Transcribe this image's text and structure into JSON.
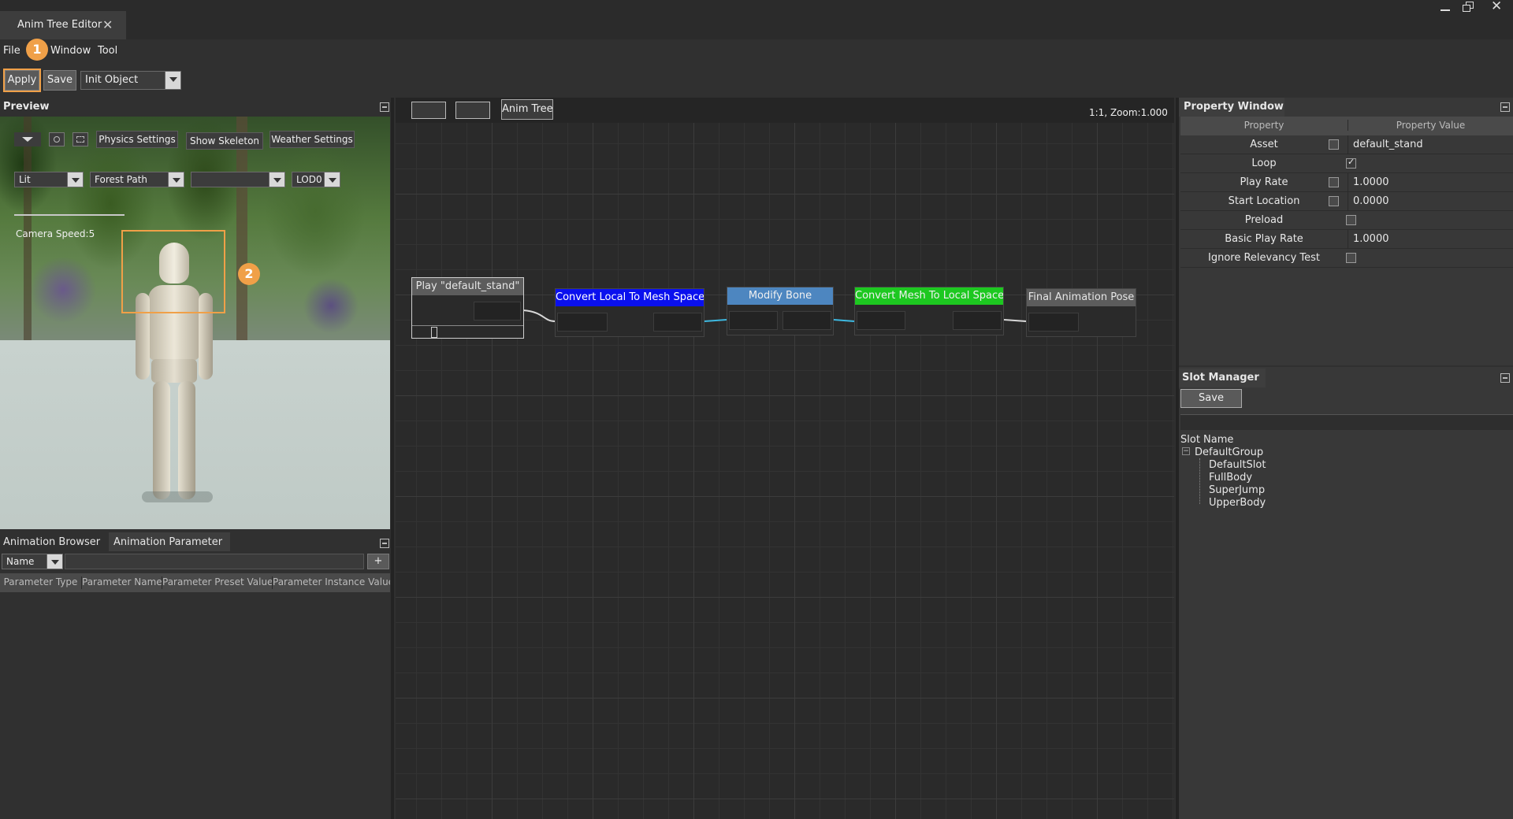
{
  "window": {
    "tab_title": "Anim Tree Editor"
  },
  "menu": [
    "File",
    "Window",
    "Tool"
  ],
  "toolbar": {
    "apply_label": "Apply",
    "save_label": "Save",
    "object_select": "Init Object"
  },
  "preview": {
    "title": "Preview",
    "physics_settings": "Physics Settings",
    "show_skeleton": "Show Skeleton",
    "weather_settings": "Weather Settings",
    "lighting_mode": "Lit",
    "environment": "Forest Path",
    "third_select": "",
    "lod": "LOD0",
    "camera_speed": "Camera Speed:5"
  },
  "bottom_left": {
    "tabs": [
      "Animation Browser",
      "Animation Parameter"
    ],
    "filter_select": "Name",
    "filter_value": "",
    "add_label": "+",
    "columns": [
      "Parameter Type",
      "Parameter Name",
      "Parameter Preset Value",
      "Parameter Instance Value"
    ]
  },
  "graph": {
    "breadcrumb_tab": "Anim Tree",
    "zoom_label": "1:1, Zoom:1.000",
    "nodes": {
      "play": "Play \"default_stand\"",
      "local_to_mesh": "Convert Local To Mesh Space",
      "modify_bone": "Modify Bone",
      "mesh_to_local": "Convert Mesh To Local Space",
      "final": "Final Animation Pose"
    }
  },
  "property_window": {
    "title": "Property Window",
    "header_property": "Property",
    "header_value": "Property Value",
    "rows": [
      {
        "label": "Asset",
        "value": "default_stand"
      },
      {
        "label": "Loop",
        "value": ""
      },
      {
        "label": "Play Rate",
        "value": "1.0000"
      },
      {
        "label": "Start Location",
        "value": "0.0000"
      },
      {
        "label": "Preload",
        "value": ""
      },
      {
        "label": "Basic Play Rate",
        "value": "1.0000"
      },
      {
        "label": "Ignore Relevancy Test",
        "value": ""
      }
    ],
    "loop_checked": true
  },
  "slot_manager": {
    "title": "Slot Manager",
    "save_label": "Save",
    "slot_name_label": "Slot Name",
    "group": "DefaultGroup",
    "slots": [
      "DefaultSlot",
      "FullBody",
      "SuperJump",
      "UpperBody"
    ]
  },
  "annotations": {
    "badge1": "1",
    "badge2": "2"
  },
  "colors": {
    "highlight": "#f0a048",
    "node_blue": "#0a10ee",
    "node_steel": "#4d86c0",
    "node_green": "#1dc820",
    "connection": "#3db8e0"
  }
}
